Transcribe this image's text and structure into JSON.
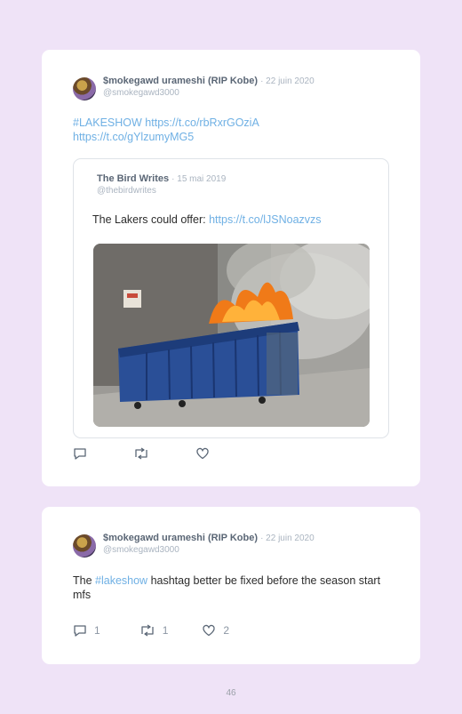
{
  "tweet1": {
    "name": "$mokegawd urameshi (RIP Kobe)",
    "date": "· 22 juin 2020",
    "handle": "@smokegawd3000",
    "text_line1_hashtag": "#LAKESHOW",
    "text_line1_link": "https://t.co/rbRxrGOziA",
    "text_line2_link": "https://t.co/gYlzumyMG5",
    "quote": {
      "name": "The Bird Writes",
      "date": "· 15 mai 2019",
      "handle": "@thebirdwrites",
      "text": "The Lakers could offer: ",
      "link": "https://t.co/lJSNoazvzs",
      "media_description_icon": "burning-dumpster-image"
    },
    "actions": {
      "reply_count": "",
      "retweet_count": "",
      "like_count": ""
    }
  },
  "tweet2": {
    "name": "$mokegawd urameshi (RIP Kobe)",
    "date": "· 22 juin 2020",
    "handle": "@smokegawd3000",
    "text_before": "The ",
    "hashtag": "#lakeshow",
    "text_after": " hashtag better be fixed before the season start mfs",
    "actions": {
      "reply_count": "1",
      "retweet_count": "1",
      "like_count": "2"
    }
  },
  "page_number": "46",
  "colors": {
    "background": "#efe3f7",
    "link": "#6fb0e4",
    "muted": "#aab4c0"
  }
}
